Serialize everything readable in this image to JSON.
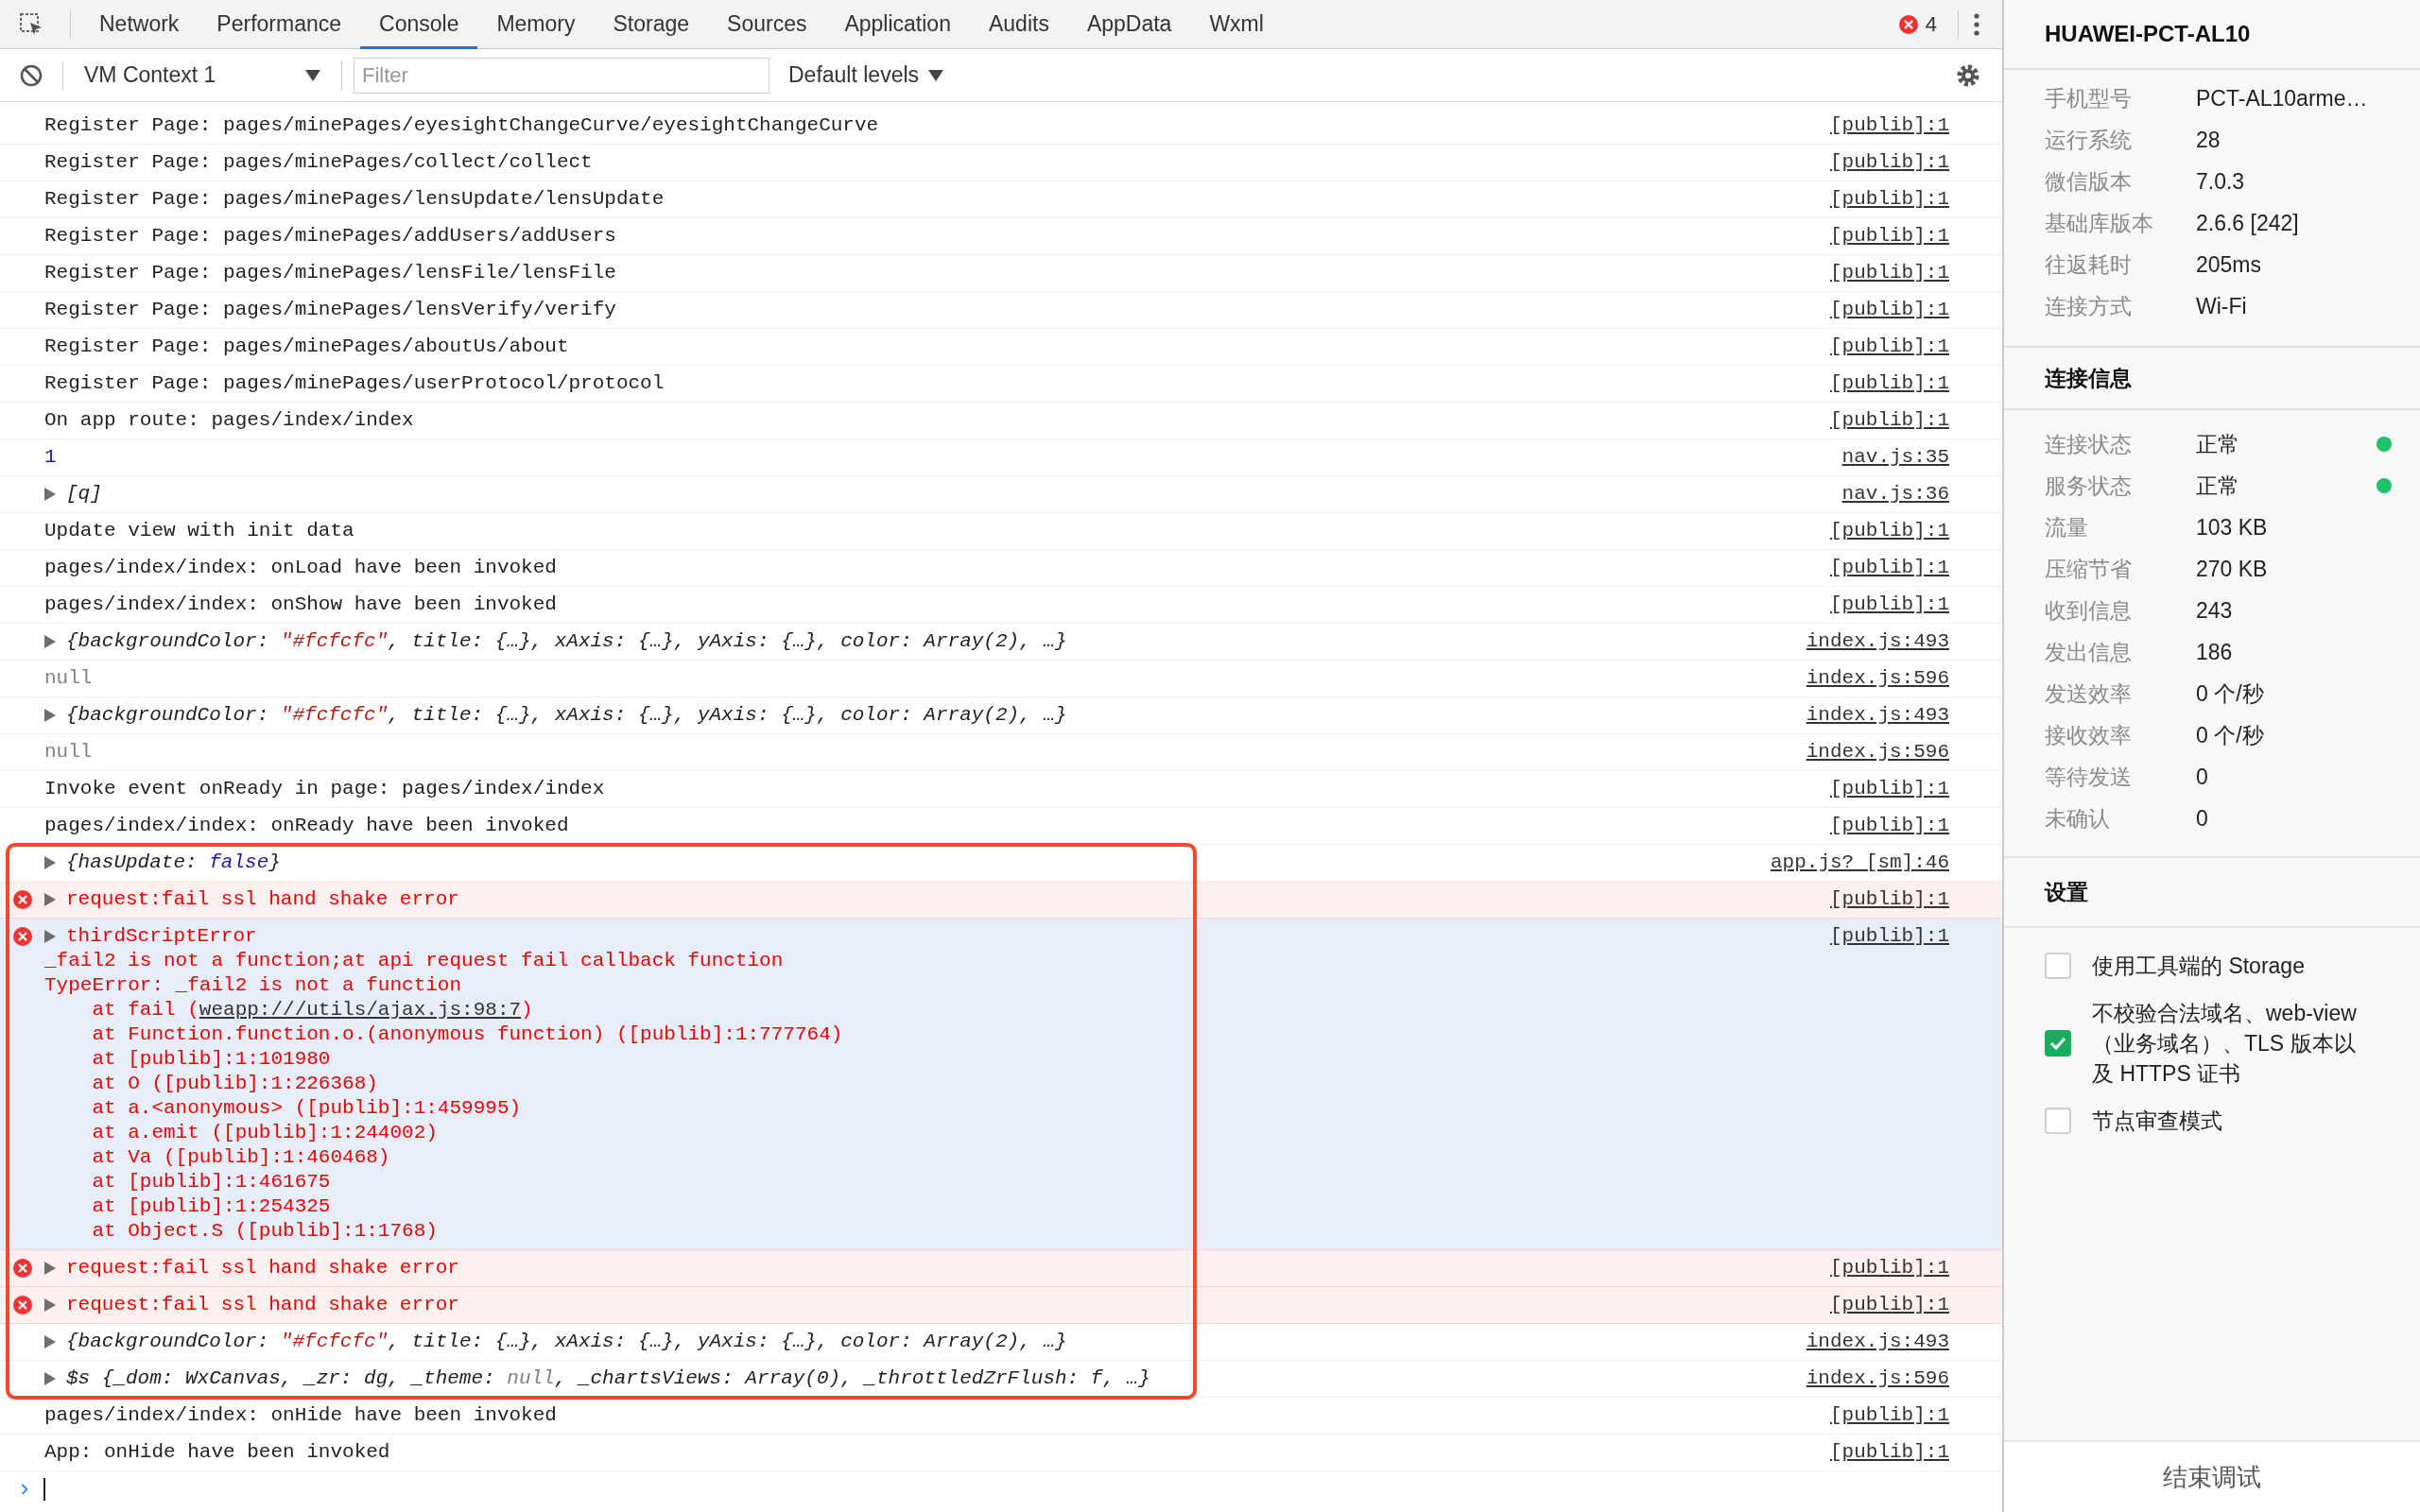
{
  "toolbar": {
    "tabs": [
      {
        "label": "Network",
        "selected": false
      },
      {
        "label": "Performance",
        "selected": false
      },
      {
        "label": "Console",
        "selected": true
      },
      {
        "label": "Memory",
        "selected": false
      },
      {
        "label": "Storage",
        "selected": false
      },
      {
        "label": "Sources",
        "selected": false
      },
      {
        "label": "Application",
        "selected": false
      },
      {
        "label": "Audits",
        "selected": false
      },
      {
        "label": "AppData",
        "selected": false
      },
      {
        "label": "Wxml",
        "selected": false
      }
    ],
    "error_count": "4"
  },
  "filter_bar": {
    "context": "VM Context 1",
    "filter": {
      "placeholder": "Filter"
    },
    "levels": "Default levels"
  },
  "console": {
    "rows": [
      {
        "kind": "log",
        "text": "Register Page: pages/minePages/eyesightChangeCurve/eyesightChangeCurve",
        "source": "[publib]:1",
        "selected": false
      },
      {
        "kind": "log",
        "text": "Register Page: pages/minePages/collect/collect",
        "source": "[publib]:1",
        "selected": false
      },
      {
        "kind": "log",
        "text": "Register Page: pages/minePages/lensUpdate/lensUpdate",
        "source": "[publib]:1",
        "selected": false
      },
      {
        "kind": "log",
        "text": "Register Page: pages/minePages/addUsers/addUsers",
        "source": "[publib]:1",
        "selected": false
      },
      {
        "kind": "log",
        "text": "Register Page: pages/minePages/lensFile/lensFile",
        "source": "[publib]:1",
        "selected": false
      },
      {
        "kind": "log",
        "text": "Register Page: pages/minePages/lensVerify/verify",
        "source": "[publib]:1",
        "selected": false
      },
      {
        "kind": "log",
        "text": "Register Page: pages/minePages/aboutUs/about",
        "source": "[publib]:1",
        "selected": false
      },
      {
        "kind": "log",
        "text": "Register Page: pages/minePages/userProtocol/protocol",
        "source": "[publib]:1",
        "selected": false
      },
      {
        "kind": "log",
        "text": "On app route: pages/index/index",
        "source": "[publib]:1",
        "selected": false
      },
      {
        "kind": "number",
        "text": "1",
        "source": "nav.js:35",
        "selected": false
      },
      {
        "kind": "object",
        "parts": [
          {
            "kind": "plain",
            "text": "[q]"
          }
        ],
        "source": "nav.js:36",
        "selected": false
      },
      {
        "kind": "log",
        "text": "Update view with init data",
        "source": "[publib]:1",
        "selected": false
      },
      {
        "kind": "log",
        "text": "pages/index/index: onLoad have been invoked",
        "source": "[publib]:1",
        "selected": false
      },
      {
        "kind": "log",
        "text": "pages/index/index: onShow have been invoked",
        "source": "[publib]:1",
        "selected": false
      },
      {
        "kind": "object",
        "parts": [
          {
            "kind": "plain",
            "text": "{backgroundColor: "
          },
          {
            "kind": "string",
            "text": "\"#fcfcfc\""
          },
          {
            "kind": "plain",
            "text": ", title: {…}, xAxis: {…}, yAxis: {…}, color: Array(2), …}"
          }
        ],
        "source": "index.js:493",
        "selected": false
      },
      {
        "kind": "null",
        "text": "null",
        "source": "index.js:596",
        "selected": false
      },
      {
        "kind": "object",
        "parts": [
          {
            "kind": "plain",
            "text": "{backgroundColor: "
          },
          {
            "kind": "string",
            "text": "\"#fcfcfc\""
          },
          {
            "kind": "plain",
            "text": ", title: {…}, xAxis: {…}, yAxis: {…}, color: Array(2), …}"
          }
        ],
        "source": "index.js:493",
        "selected": false
      },
      {
        "kind": "null",
        "text": "null",
        "source": "index.js:596",
        "selected": false
      },
      {
        "kind": "log",
        "text": "Invoke event onReady in page: pages/index/index",
        "source": "[publib]:1",
        "selected": false
      },
      {
        "kind": "log",
        "text": "pages/index/index: onReady have been invoked",
        "source": "[publib]:1",
        "selected": false
      }
    ],
    "highlighted_rows": [
      {
        "kind": "object",
        "parts": [
          {
            "kind": "plain",
            "text": "{hasUpdate: "
          },
          {
            "kind": "keyword",
            "text": "false"
          },
          {
            "kind": "plain",
            "text": "}"
          }
        ],
        "source": "app.js? [sm]:46",
        "selected": false
      },
      {
        "kind": "error",
        "text": "request:fail ssl hand shake error",
        "source": "[publib]:1",
        "selected": false
      },
      {
        "kind": "error",
        "text": "thirdScriptError",
        "source": "[publib]:1",
        "selected": true,
        "stack": [
          {
            "text": "_fail2 is not a function;at api request fail callback function"
          },
          {
            "text": "TypeError: _fail2 is not a function"
          },
          {
            "text": "    at fail (",
            "link": "weapp:///utils/ajax.js:98:7",
            "after": ")"
          },
          {
            "text": "    at Function.function.o.(anonymous function) ([publib]:1:777764)"
          },
          {
            "text": "    at [publib]:1:101980"
          },
          {
            "text": "    at O ([publib]:1:226368)"
          },
          {
            "text": "    at a.<anonymous> ([publib]:1:459995)"
          },
          {
            "text": "    at a.emit ([publib]:1:244002)"
          },
          {
            "text": "    at Va ([publib]:1:460468)"
          },
          {
            "text": "    at [publib]:1:461675"
          },
          {
            "text": "    at [publib]:1:254325"
          },
          {
            "text": "    at Object.S ([publib]:1:1768)"
          }
        ]
      },
      {
        "kind": "error",
        "text": "request:fail ssl hand shake error",
        "source": "[publib]:1",
        "selected": false
      },
      {
        "kind": "error",
        "text": "request:fail ssl hand shake error",
        "source": "[publib]:1",
        "selected": false
      },
      {
        "kind": "object",
        "parts": [
          {
            "kind": "plain",
            "text": "{backgroundColor: "
          },
          {
            "kind": "string",
            "text": "\"#fcfcfc\""
          },
          {
            "kind": "plain",
            "text": ", title: {…}, xAxis: {…}, yAxis: {…}, color: Array(2), …}"
          }
        ],
        "source": "index.js:493",
        "selected": false
      },
      {
        "kind": "object",
        "parts": [
          {
            "kind": "plain",
            "text": "$s {_dom: WxCanvas, _zr: dg, _theme: "
          },
          {
            "kind": "null",
            "text": "null"
          },
          {
            "kind": "plain",
            "text": ", _chartsViews: Array(0), _throttledZrFlush: f, …}"
          }
        ],
        "source": "index.js:596",
        "selected": false
      }
    ],
    "rows_after": [
      {
        "kind": "log",
        "text": "pages/index/index: onHide have been invoked",
        "source": "[publib]:1",
        "selected": false
      },
      {
        "kind": "log",
        "text": "App: onHide have been invoked",
        "source": "[publib]:1",
        "selected": false
      }
    ],
    "prompt": "›"
  },
  "sidebar": {
    "device": "HUAWEI-PCT-AL10",
    "info": [
      {
        "label": "手机型号",
        "value": "PCT-AL10arme…"
      },
      {
        "label": "运行系统",
        "value": "28"
      },
      {
        "label": "微信版本",
        "value": "7.0.3"
      },
      {
        "label": "基础库版本",
        "value": "2.6.6 [242]"
      },
      {
        "label": "往返耗时",
        "value": "205ms"
      },
      {
        "label": "连接方式",
        "value": "Wi-Fi"
      }
    ],
    "connection_title": "连接信息",
    "connection": [
      {
        "label": "连接状态",
        "value": "正常",
        "color": "#1ec26a"
      },
      {
        "label": "服务状态",
        "value": "正常",
        "color": "#1ec26a"
      },
      {
        "label": "流量",
        "value": "103 KB"
      },
      {
        "label": "压缩节省",
        "value": "270 KB"
      },
      {
        "label": "收到信息",
        "value": "243"
      },
      {
        "label": "发出信息",
        "value": "186"
      },
      {
        "label": "发送效率",
        "value": "0 个/秒"
      },
      {
        "label": "接收效率",
        "value": "0 个/秒"
      },
      {
        "label": "等待发送",
        "value": "0"
      },
      {
        "label": "未确认",
        "value": "0"
      }
    ],
    "settings_title": "设置",
    "settings": [
      {
        "label": "使用工具端的 Storage",
        "checked": false
      },
      {
        "label": "不校验合法域名、web-view（业务域名）、TLS 版本以及 HTTPS 证书",
        "checked": true
      },
      {
        "label": "节点审查模式",
        "checked": false
      }
    ],
    "end_button": "结束调试"
  }
}
